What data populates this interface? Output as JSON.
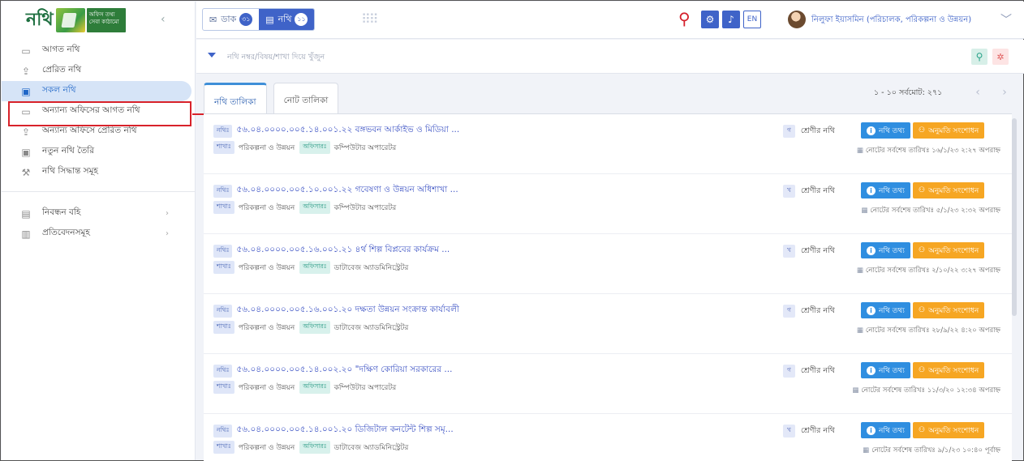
{
  "logo": {
    "word": "নথি",
    "box_text": "অফিস তথ্য সেবা কাঠামো"
  },
  "sidebar": {
    "items": [
      {
        "label": "আগত নথি",
        "icon": "inbox-icon",
        "glyph": "▭"
      },
      {
        "label": "প্রেরিত নথি",
        "icon": "outbox-icon",
        "glyph": "⇪"
      },
      {
        "label": "সকল নথি",
        "icon": "folder-stack-icon",
        "glyph": "▣"
      },
      {
        "label": "অন্যান্য অফিসের আগত নথি",
        "icon": "inbox-icon",
        "glyph": "▭"
      },
      {
        "label": "অন্যান্য অফিসে প্রেরিত নথি",
        "icon": "outbox-icon",
        "glyph": "⇪"
      },
      {
        "label": "নতুন নথি তৈরি",
        "icon": "new-file-icon",
        "glyph": "▣"
      },
      {
        "label": "নথি সিদ্ধান্ত সমূহ",
        "icon": "gavel-icon",
        "glyph": "⚒"
      }
    ],
    "groups": [
      {
        "label": "নিবন্ধন বহি",
        "icon": "register-book-icon",
        "glyph": "▤"
      },
      {
        "label": "প্রতিবেদনসমূহ",
        "icon": "report-icon",
        "glyph": "▥"
      }
    ]
  },
  "topbar": {
    "tabs": [
      {
        "label": "ডাক",
        "badge": "৩১",
        "icon": "mail-icon",
        "glyph": "✉"
      },
      {
        "label": "নথি",
        "badge": "১১",
        "icon": "file-icon",
        "glyph": "▤"
      }
    ],
    "lang": "EN",
    "user_name": "নিলুফা ইয়াসমিন (পরিচালক, পরিকল্পনা ও উন্নয়ন)"
  },
  "search": {
    "placeholder": "নথি নম্বর/বিষয়/শাখা দিয়ে খুঁজুন"
  },
  "panel": {
    "tabs": [
      "নথি তালিকা",
      "নোট তালিকা"
    ],
    "pager": "১ - ১০ সর্বমোট: ২৭১"
  },
  "labels": {
    "file_tag": "নথিঃ",
    "branch_tag": "শাখাঃ",
    "owner_tag": "অফিসারঃ",
    "class_text": "শ্রেণীর নথি",
    "info_btn": "নথি তথ্য",
    "perm_btn": "অনুমতি সংশোধন"
  },
  "rows": [
    {
      "title": "৫৬.০৪.০০০০.০০৫.১৪.০০১.২২ বঙ্গভবন আর্কাইভ ও মিডিয়া ...",
      "branch": "পরিকল্পনা ও উন্নয়ন",
      "officer": "কম্পিউটার অপারেটর",
      "class": "গ",
      "date": "নোটের সর্বশেষ তারিখঃ ১৬/১/২৩ ২:২৭ অপরাহ্ন"
    },
    {
      "title": "৫৬.০৪.০০০০.০০৫.১০.০০১.২২ গবেষণা ও উন্নয়ন অধিশাখা ...",
      "branch": "পরিকল্পনা ও উন্নয়ন",
      "officer": "কম্পিউটার অপারেটর",
      "class": "খ",
      "date": "নোটের সর্বশেষ তারিখঃ ৫/১/২৩ ২:৩২ অপরাহ্ন"
    },
    {
      "title": "৫৬.০৪.০০০০.০০৫.১৬.০০১.২১ ৪র্থ শিল্প বিপ্লবের কার্যক্রম ...",
      "branch": "পরিকল্পনা ও উন্নয়ন",
      "officer": "ডাটাবেজ অ্যাডমিনিস্ট্রেটর",
      "class": "খ",
      "date": "নোটের সর্বশেষ তারিখঃ ২/১০/২২ ৩:২৭ অপরাহ্ন"
    },
    {
      "title": "৫৬.০৪.০০০০.০০৫.১৬.০০১.২০ দক্ষতা উন্নয়ন সংক্রান্ত কার্যাবলী",
      "branch": "পরিকল্পনা ও উন্নয়ন",
      "officer": "ডাটাবেজ অ্যাডমিনিস্ট্রেটর",
      "class": "গ",
      "date": "নোটের সর্বশেষ তারিখঃ ২৮/৯/২২ ৪:২০ অপরাহ্ন"
    },
    {
      "title": "৫৬.০৪.০০০০.০০৫.১৪.০০২.২০ \"দক্ষিণ কোরিয়া সরকারের ...",
      "branch": "পরিকল্পনা ও উন্নয়ন",
      "officer": "কম্পিউটার অপারেটর",
      "class": "গ",
      "date": "নোটের সর্বশেষ তারিখঃ ১১/৩/২০ ১২:৩৪ অপরাহ্ন"
    },
    {
      "title": "৫৬.০৪.০০০০.০০৫.১৪.০০১.২০ ডিজিটাল কনটেন্ট শিল্প সমৃ...",
      "branch": "পরিকল্পনা ও উন্নয়ন",
      "officer": "ডাটাবেজ অ্যাডমিনিস্ট্রেটর",
      "class": "খ",
      "date": "নোটের সর্বশেষ তারিখঃ ৯/১/২৩ ১০:৪০ পূর্বাহ্ন"
    }
  ]
}
